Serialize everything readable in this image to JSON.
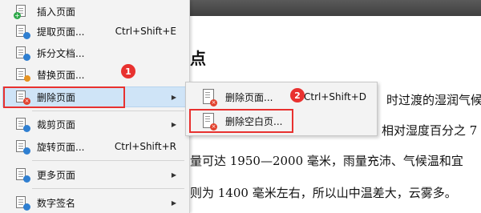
{
  "document": {
    "heading": "点",
    "lines": [
      "时过渡的湿润气候",
      "相对湿度百分之 7",
      "量可达 1950—2000 毫米，雨量充沛、气候温和宜",
      "则为 1400 毫米左右，所以山中温差大，云雾多。"
    ]
  },
  "menu": {
    "items": [
      {
        "label": "插入页面",
        "icon": "insert-page-icon"
      },
      {
        "label": "提取页面...",
        "shortcut": "Ctrl+Shift+E",
        "icon": "extract-page-icon"
      },
      {
        "label": "拆分文档...",
        "icon": "split-document-icon"
      },
      {
        "label": "替换页面...",
        "icon": "replace-page-icon"
      },
      {
        "label": "删除页面",
        "icon": "delete-page-icon",
        "has_submenu": true
      },
      {
        "label": "裁剪页面",
        "icon": "crop-page-icon",
        "has_submenu": true
      },
      {
        "label": "旋转页面...",
        "shortcut": "Ctrl+Shift+R",
        "icon": "rotate-page-icon"
      },
      {
        "label": "更多页面",
        "icon": "more-pages-icon",
        "has_submenu": true
      },
      {
        "label": "数字签名",
        "icon": "digital-signature-icon",
        "has_submenu": true
      }
    ],
    "submenu_arrow": "▶"
  },
  "submenu": {
    "items": [
      {
        "label": "删除页面...",
        "shortcut": "Ctrl+Shift+D",
        "icon": "delete-pages-icon"
      },
      {
        "label": "删除空白页...",
        "icon": "delete-blank-pages-icon"
      }
    ]
  },
  "annotations": {
    "badge1": "1",
    "badge2": "2",
    "color": "#e8312f"
  }
}
